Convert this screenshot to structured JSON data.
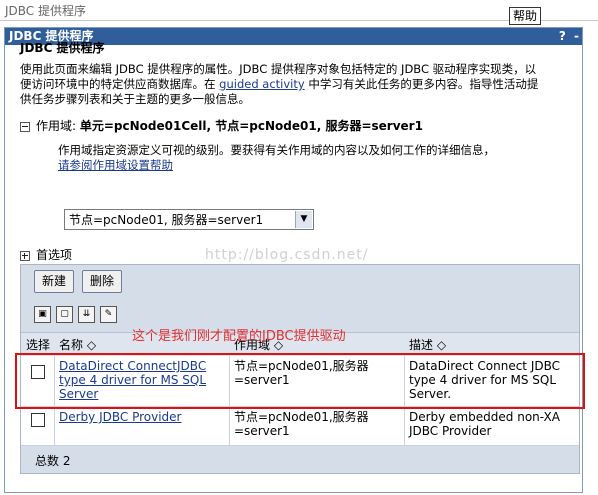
{
  "window_title": "JDBC 提供程序",
  "help_label": "帮助",
  "panel": {
    "header": "JDBC 提供程序",
    "controls": [
      "?",
      "-"
    ]
  },
  "page_title": "JDBC 提供程序",
  "description": {
    "line1": "使用此页面来编辑 JDBC 提供程序的属性。JDBC 提供程序对象包括特定的 JDBC 驱动程序实现类，以",
    "line2_pre": "便访问环境中的特定供应商数据库。在 ",
    "link": "guided activity",
    "line2_post": " 中学习有关此任务的更多内容。指导性活动提",
    "line3": "供任务步骤列表和关于主题的更多一般信息。"
  },
  "scope": {
    "label": "作用域:",
    "value": "单元=pcNode01Cell, 节点=pcNode01, 服务器=server1",
    "desc_line1": "作用域指定资源定义可视的级别。要获得有关作用域的内容以及如何工作的详细信息，",
    "desc_link": "请参阅作用域设置帮助",
    "selected": "节点=pcNode01, 服务器=server1"
  },
  "preferences_label": "首选项",
  "watermark": "http://blog.csdn.net/",
  "toolbar": {
    "new_label": "新建",
    "delete_label": "删除"
  },
  "icon_buttons": [
    "select-all-icon",
    "deselect-all-icon",
    "show-filter-icon",
    "clear-filter-icon"
  ],
  "table": {
    "headers": {
      "select": "选择",
      "name": "名称",
      "scope": "作用域",
      "description": "描述"
    },
    "rows": [
      {
        "name_line1": "DataDirect ConnectJDBC",
        "name_line2": "type 4 driver for MS SQL",
        "name_line3": "Server",
        "scope_line1": "节点=pcNode01,服务器",
        "scope_line2": "=server1",
        "desc_line1": "DataDirect Connect JDBC",
        "desc_line2": "type 4 driver for MS SQL",
        "desc_line3": "Server."
      },
      {
        "name_line1": "Derby JDBC Provider",
        "scope_line1": "节点=pcNode01,服务器",
        "scope_line2": "=server1",
        "desc_line1": "Derby embedded non-XA",
        "desc_line2": "JDBC Provider"
      }
    ],
    "total": "总数 2"
  },
  "annotation": "这个是我们刚才配置的JDBC提供驱动",
  "colors": {
    "panel_header": "#2f5e9a",
    "link": "#1a3a8f",
    "annotation": "#e03030",
    "highlight_box": "#e01010"
  }
}
